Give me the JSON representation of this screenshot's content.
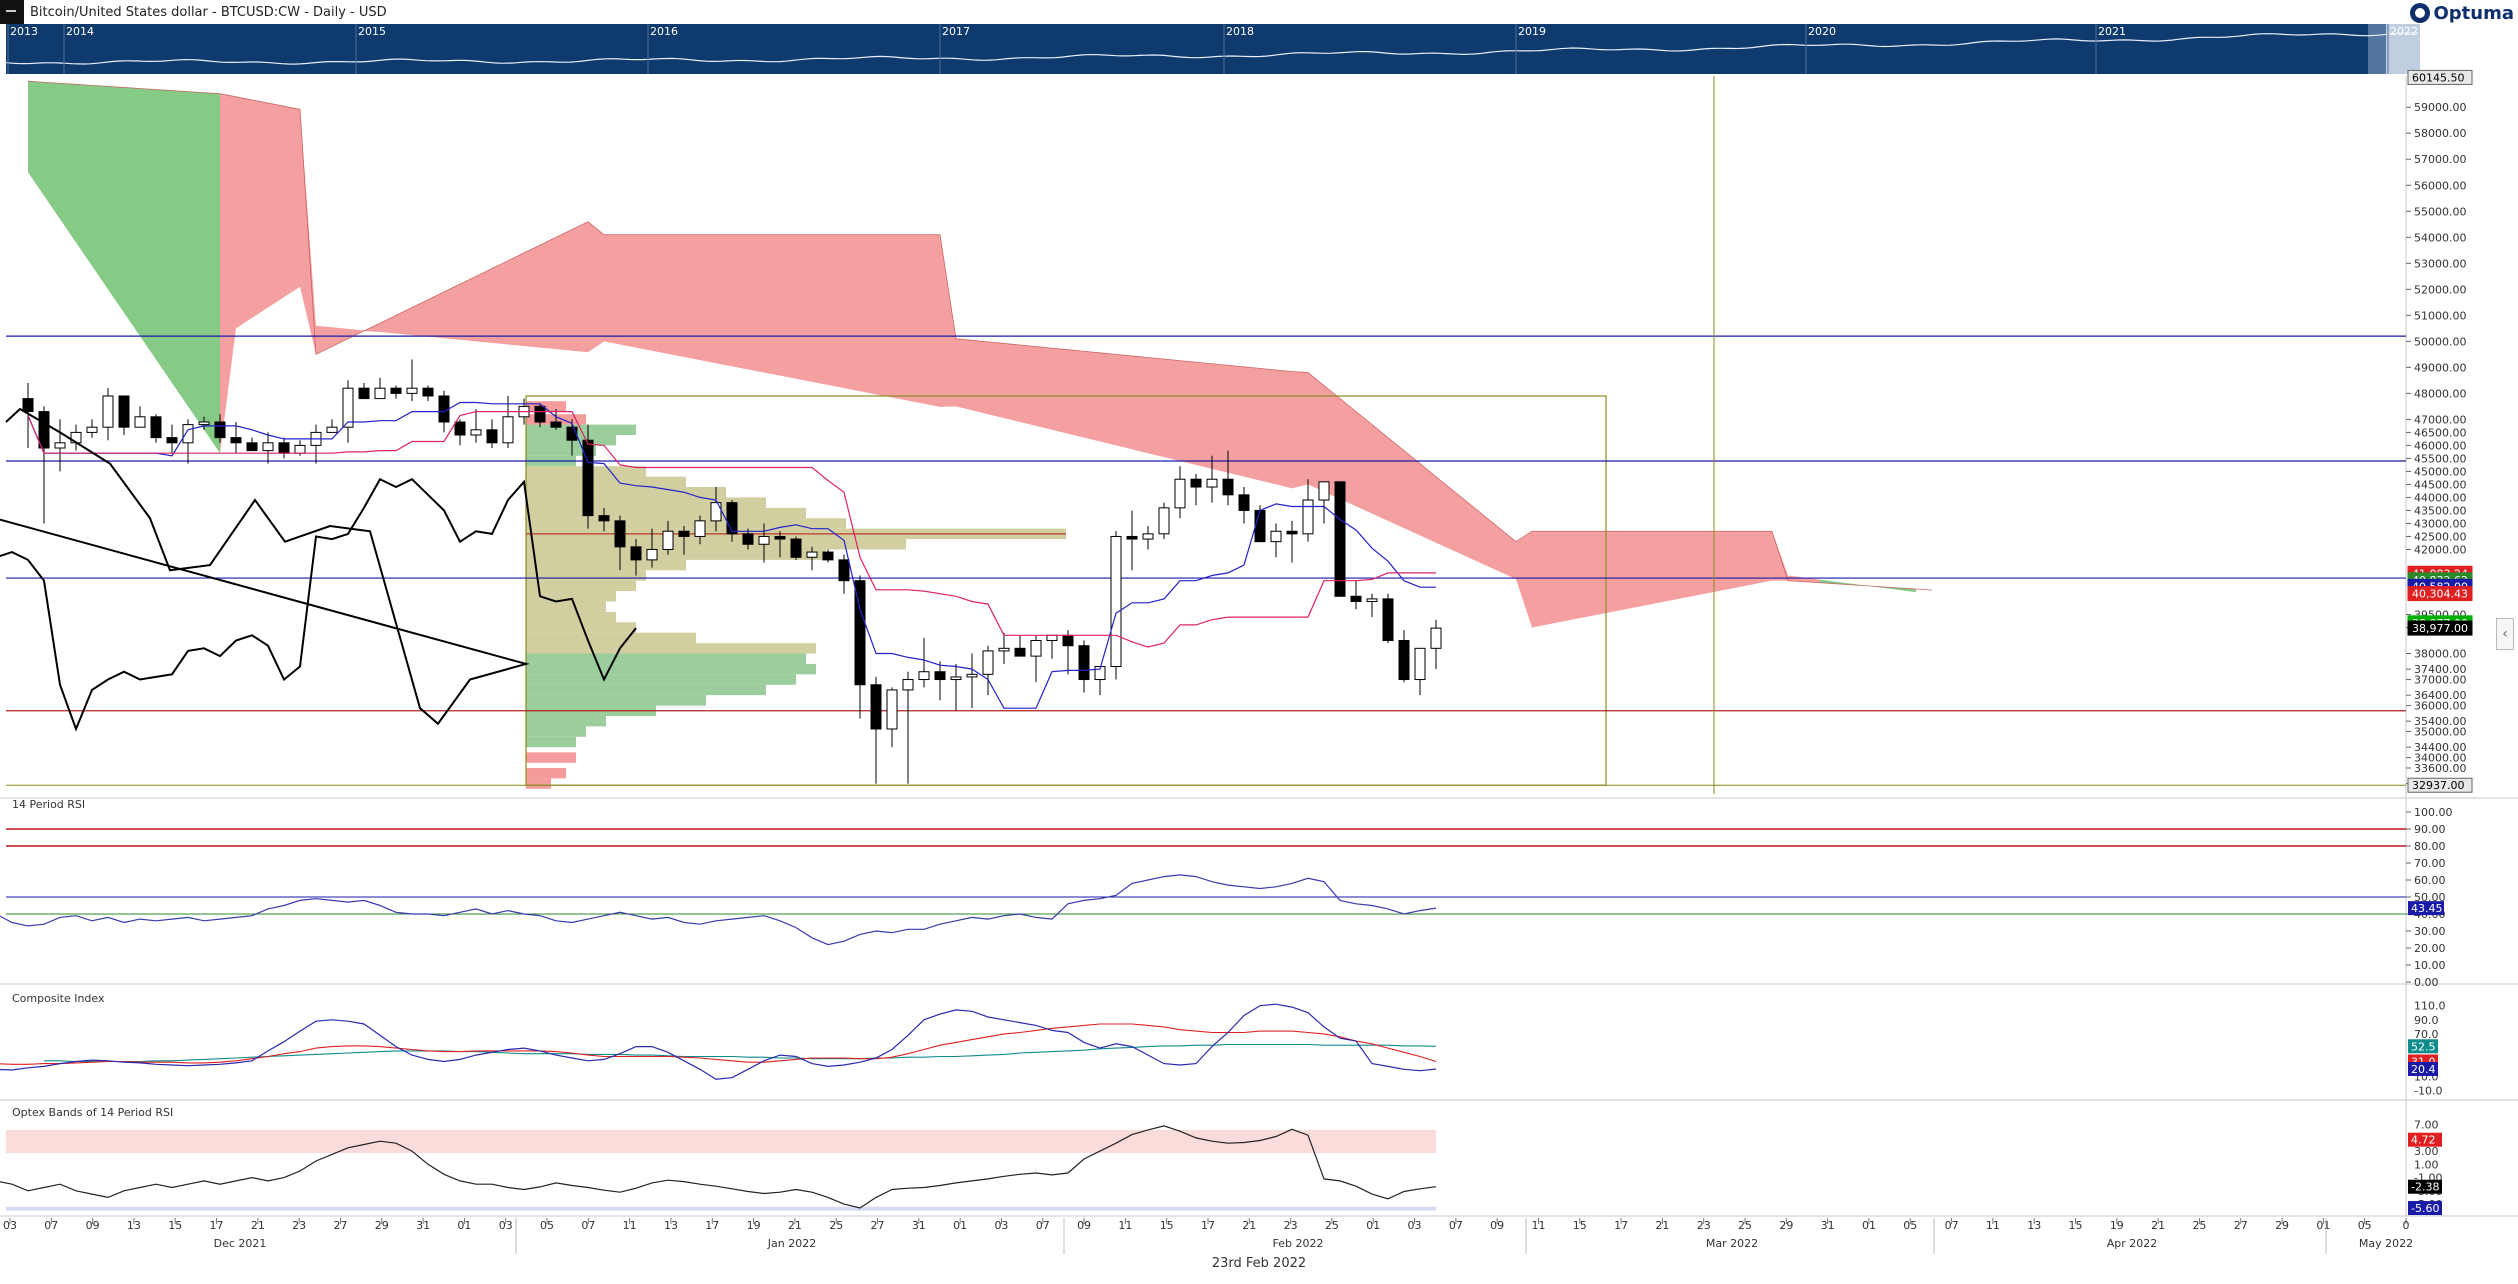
{
  "header": {
    "title": "Bitcoin/United States dollar - BTCUSD:CW - Daily - USD"
  },
  "logo": {
    "text": "Optuma"
  },
  "footer": {
    "date": "23rd Feb 2022"
  },
  "overview": {
    "years": [
      "2013",
      "2014",
      "2015",
      "2016",
      "2017",
      "2018",
      "2019",
      "2020",
      "2021",
      "2022"
    ]
  },
  "price_panel": {
    "y_ticks": [
      59000,
      58000,
      57000,
      56000,
      55000,
      54000,
      53000,
      52000,
      51000,
      50000,
      49000,
      48000,
      47000,
      46500,
      46000,
      45500,
      45000,
      44500,
      44000,
      43500,
      43000,
      42500,
      42000,
      39500,
      39000,
      38000,
      37400,
      37000,
      36400,
      36000,
      35400,
      35000,
      34400,
      34000,
      33600,
      33000
    ],
    "price_badges": [
      {
        "text": "60145.50",
        "value": 60145.5,
        "bg": "#e8e8e8",
        "fg": "#000"
      },
      {
        "text": "41,083.24",
        "value": 41083.24,
        "bg": "#e02020",
        "fg": "#fff"
      },
      {
        "text": "40,832.62",
        "value": 40832.62,
        "bg": "#2a8a2a",
        "fg": "#fff"
      },
      {
        "text": "40,582.00",
        "value": 40582,
        "bg": "#1a1aa8",
        "fg": "#fff"
      },
      {
        "text": "40,304.43",
        "value": 40304.43,
        "bg": "#e02020",
        "fg": "#fff"
      },
      {
        "text": "38,977.00",
        "value": 39180,
        "bg": "#00b000",
        "fg": "#fff"
      },
      {
        "text": "38,977.00",
        "value": 38977,
        "bg": "#000",
        "fg": "#fff"
      },
      {
        "text": "32937.00",
        "value": 32937,
        "bg": "#e8e8e8",
        "fg": "#000"
      }
    ]
  },
  "rsi_panel": {
    "title": "14 Period RSI",
    "y_ticks": [
      "100.00",
      "90.00",
      "80.00",
      "70.00",
      "60.00",
      "50.00",
      "40.00",
      "30.00",
      "20.00",
      "10.00",
      "0.00"
    ],
    "badge": "43.45",
    "badge_color": "#1a1aa8"
  },
  "ci_panel": {
    "title": "Composite Index",
    "y_ticks": [
      "110.0",
      "90.0",
      "70.0",
      "30.0",
      "10.0",
      "-10.0"
    ],
    "badges": [
      {
        "text": "52.5",
        "bg": "#0e8b8b"
      },
      {
        "text": "31.0",
        "bg": "#e02020"
      },
      {
        "text": "20.4",
        "bg": "#1a1aa8"
      }
    ]
  },
  "optex_panel": {
    "title": "Optex Bands of 14 Period RSI",
    "y_ticks": [
      "7.00",
      "5.00",
      "3.00",
      "1.00",
      "-1.00",
      "-3.00",
      "-5.00"
    ],
    "badges": [
      {
        "text": "4.72",
        "value": 4.72,
        "bg": "#e02020"
      },
      {
        "text": "-2.38",
        "value": -2.38,
        "bg": "#000"
      },
      {
        "text": "-5.60",
        "value": -5.6,
        "bg": "#1a1aa8"
      }
    ]
  },
  "x_axis": {
    "day_labels": [
      "03",
      "07",
      "09",
      "13",
      "15",
      "17",
      "21",
      "23",
      "27",
      "29",
      "31",
      "01",
      "03",
      "05",
      "07",
      "11",
      "13",
      "17",
      "19",
      "21",
      "25",
      "27",
      "31",
      "01",
      "03",
      "07",
      "09",
      "11",
      "15",
      "17",
      "21",
      "23",
      "25",
      "01",
      "03",
      "07",
      "09",
      "11",
      "15",
      "17",
      "21",
      "23",
      "25",
      "29",
      "31",
      "01",
      "05",
      "07",
      "11",
      "13",
      "15",
      "19",
      "21",
      "25",
      "27",
      "29",
      "01",
      "05",
      "0"
    ],
    "month_labels": [
      "Dec 2021",
      "Jan 2022",
      "Feb 2022",
      "Mar 2022",
      "Apr 2022",
      "May 2022"
    ]
  },
  "colors": {
    "bull_cloud": "#f08080",
    "bear_cloud": "#5cb85c",
    "tenkan": "#2222cc",
    "kijun": "#dd2266",
    "chikou": "#000000",
    "volume_up": "#8bc48b",
    "volume_neutral": "#c9c58f",
    "volume_down": "#f28b8b",
    "navy": "#0e3a6e"
  },
  "chart_data": {
    "type": "candlestick",
    "title": "Bitcoin/United States dollar - BTCUSD:CW - Daily - USD",
    "ylim": [
      32600,
      60200
    ],
    "candles": [
      [
        47800,
        48400,
        45900,
        47300
      ],
      [
        47300,
        47500,
        43000,
        45900
      ],
      [
        45900,
        47000,
        45000,
        46100
      ],
      [
        46100,
        46800,
        45800,
        46500
      ],
      [
        46500,
        47000,
        46300,
        46700
      ],
      [
        46700,
        48200,
        46200,
        47900
      ],
      [
        47900,
        47900,
        46400,
        46700
      ],
      [
        46700,
        47500,
        47000,
        47100
      ],
      [
        47100,
        47200,
        46100,
        46300
      ],
      [
        46300,
        46800,
        45700,
        46100
      ],
      [
        46100,
        47000,
        45300,
        46800
      ],
      [
        46800,
        47100,
        46600,
        46900
      ],
      [
        46900,
        47200,
        46100,
        46300
      ],
      [
        46300,
        46900,
        45700,
        46100
      ],
      [
        46100,
        46300,
        45800,
        45800
      ],
      [
        45800,
        46500,
        45300,
        46100
      ],
      [
        46100,
        46300,
        45500,
        45700
      ],
      [
        45700,
        46200,
        45600,
        46000
      ],
      [
        46000,
        46800,
        45300,
        46500
      ],
      [
        46500,
        47000,
        46500,
        46700
      ],
      [
        46700,
        48500,
        46100,
        48200
      ],
      [
        48200,
        48400,
        47800,
        47800
      ],
      [
        47800,
        48600,
        47800,
        48200
      ],
      [
        48200,
        48300,
        47800,
        48000
      ],
      [
        48000,
        49300,
        47700,
        48200
      ],
      [
        48200,
        48300,
        47700,
        47900
      ],
      [
        47900,
        48100,
        46500,
        46900
      ],
      [
        46900,
        47000,
        46000,
        46400
      ],
      [
        46400,
        47400,
        46100,
        46600
      ],
      [
        46600,
        47000,
        45900,
        46100
      ],
      [
        46100,
        47900,
        45900,
        47100
      ],
      [
        47100,
        47800,
        46800,
        47500
      ],
      [
        47500,
        47600,
        46700,
        46900
      ],
      [
        46900,
        47400,
        46600,
        46700
      ],
      [
        46700,
        47000,
        45600,
        46200
      ],
      [
        46200,
        46800,
        42800,
        43300
      ],
      [
        43300,
        43600,
        42700,
        43100
      ],
      [
        43100,
        43300,
        41200,
        42100
      ],
      [
        42100,
        42400,
        41000,
        41600
      ],
      [
        41600,
        42800,
        41300,
        42000
      ],
      [
        42000,
        43100,
        41800,
        42700
      ],
      [
        42700,
        42900,
        41800,
        42500
      ],
      [
        42500,
        43300,
        42200,
        43100
      ],
      [
        43100,
        44400,
        42700,
        43800
      ],
      [
        43800,
        43900,
        42300,
        42600
      ],
      [
        42600,
        42800,
        42000,
        42200
      ],
      [
        42200,
        43000,
        41500,
        42500
      ],
      [
        42500,
        42700,
        41700,
        42400
      ],
      [
        42400,
        42500,
        41600,
        41700
      ],
      [
        41700,
        42100,
        41200,
        41900
      ],
      [
        41900,
        42000,
        41500,
        41600
      ],
      [
        41600,
        41800,
        40300,
        40800
      ],
      [
        40800,
        41000,
        35500,
        36800
      ],
      [
        36800,
        37100,
        33000,
        35100
      ],
      [
        35100,
        36700,
        34400,
        36600
      ],
      [
        36600,
        37300,
        33000,
        37000
      ],
      [
        37000,
        38600,
        36700,
        37300
      ],
      [
        37300,
        37700,
        36200,
        37000
      ],
      [
        37000,
        37600,
        35800,
        37100
      ],
      [
        37100,
        38000,
        35900,
        37200
      ],
      [
        37200,
        38300,
        36400,
        38100
      ],
      [
        38100,
        38800,
        37600,
        38200
      ],
      [
        38200,
        38700,
        37900,
        37900
      ],
      [
        37900,
        38700,
        36900,
        38500
      ],
      [
        38500,
        38700,
        37800,
        38700
      ],
      [
        38700,
        38900,
        37200,
        38300
      ],
      [
        38300,
        38500,
        36500,
        37000
      ],
      [
        37000,
        37500,
        36400,
        37500
      ],
      [
        37500,
        42700,
        37000,
        42500
      ],
      [
        42500,
        43500,
        41200,
        42400
      ],
      [
        42400,
        42900,
        42000,
        42600
      ],
      [
        42600,
        43800,
        42400,
        43600
      ],
      [
        43600,
        45200,
        43200,
        44700
      ],
      [
        44700,
        44900,
        43700,
        44400
      ],
      [
        44400,
        45600,
        43800,
        44700
      ],
      [
        44700,
        45800,
        43700,
        44100
      ],
      [
        44100,
        44400,
        43000,
        43500
      ],
      [
        43500,
        43700,
        42300,
        42300
      ],
      [
        42300,
        43000,
        41700,
        42700
      ],
      [
        42700,
        43100,
        41500,
        42600
      ],
      [
        42600,
        44700,
        42300,
        43900
      ],
      [
        43900,
        44500,
        43000,
        44600
      ],
      [
        44600,
        44600,
        40500,
        40200
      ],
      [
        40200,
        40800,
        39700,
        40000
      ],
      [
        40000,
        40300,
        39400,
        40100
      ],
      [
        40100,
        40300,
        38400,
        38500
      ],
      [
        38500,
        38900,
        36900,
        37000
      ],
      [
        37000,
        38200,
        36400,
        38200
      ],
      [
        38200,
        39300,
        37400,
        38977
      ]
    ],
    "horizontal_levels": [
      {
        "value": 50200,
        "color": "#1a1aa8"
      },
      {
        "value": 45400,
        "color": "#1a1aa8"
      },
      {
        "value": 40900,
        "color": "#1a1aa8"
      },
      {
        "value": 35800,
        "color": "#b02020"
      }
    ],
    "rsi": [
      36,
      40,
      35,
      33,
      34,
      38,
      39,
      36,
      38,
      35,
      37,
      36,
      37,
      38,
      36,
      37,
      38,
      39,
      43,
      45,
      48,
      49,
      48,
      47,
      48,
      45,
      41,
      40,
      40,
      39,
      41,
      43,
      40,
      42,
      40,
      39,
      36,
      35,
      37,
      39,
      41,
      39,
      37,
      38,
      35,
      34,
      36,
      37,
      38,
      39,
      36,
      32,
      26,
      22,
      24,
      28,
      30,
      29,
      31,
      31,
      34,
      36,
      38,
      37,
      39,
      40,
      38,
      37,
      46,
      48,
      49,
      51,
      58,
      60,
      62,
      63,
      62,
      59,
      57,
      56,
      55,
      56,
      58,
      61,
      59,
      48,
      46,
      45,
      43,
      40,
      42,
      43.45
    ],
    "ci_blue": [
      24,
      22,
      20,
      19,
      22,
      24,
      28,
      31,
      33,
      32,
      30,
      29,
      27,
      26,
      25,
      26,
      27,
      29,
      32,
      46,
      59,
      74,
      88,
      90,
      88,
      84,
      68,
      52,
      40,
      34,
      31,
      34,
      40,
      44,
      48,
      50,
      46,
      40,
      36,
      32,
      34,
      42,
      52,
      52,
      44,
      32,
      20,
      6,
      8,
      20,
      32,
      40,
      38,
      28,
      24,
      26,
      30,
      36,
      48,
      68,
      90,
      98,
      104,
      102,
      94,
      90,
      86,
      82,
      75,
      72,
      58,
      50,
      56,
      52,
      40,
      28,
      26,
      28,
      52,
      72,
      96,
      110,
      112,
      108,
      100,
      80,
      64,
      60,
      28,
      24,
      20,
      18,
      20.4
    ],
    "ci_red": [
      30,
      29,
      28,
      27,
      27,
      28,
      28,
      29,
      30,
      31,
      31,
      30,
      30,
      30,
      29,
      29,
      30,
      32,
      35,
      38,
      42,
      45,
      50,
      52,
      53,
      53,
      52,
      50,
      48,
      46,
      45,
      45,
      46,
      46,
      46,
      46,
      46,
      45,
      43,
      40,
      38,
      38,
      38,
      38,
      38,
      37,
      36,
      34,
      32,
      30,
      30,
      32,
      34,
      36,
      36,
      36,
      35,
      35,
      37,
      42,
      48,
      54,
      58,
      62,
      66,
      70,
      72,
      75,
      78,
      80,
      82,
      84,
      84,
      84,
      82,
      80,
      76,
      74,
      72,
      72,
      72,
      74,
      74,
      74,
      72,
      70,
      66,
      60,
      56,
      50,
      44,
      38,
      31.0
    ],
    "ci_teal": [
      32,
      32,
      31,
      31,
      31,
      31,
      31,
      32,
      32,
      33,
      34,
      35,
      36,
      37,
      38,
      39,
      40,
      41,
      42,
      43,
      44,
      45,
      46,
      46,
      46,
      46,
      45,
      45,
      44,
      43,
      42,
      42,
      42,
      42,
      41,
      41,
      41,
      40,
      40,
      39,
      38,
      38,
      38,
      38,
      37,
      37,
      36,
      36,
      35,
      35,
      35,
      35,
      36,
      36,
      37,
      37,
      38,
      38,
      39,
      40,
      41,
      43,
      44,
      45,
      46,
      47,
      49,
      50,
      51,
      52,
      53,
      53,
      54,
      54,
      55,
      55,
      55,
      55,
      55,
      55,
      54,
      54,
      54,
      54,
      54,
      53,
      53,
      52.5
    ],
    "optex": [
      -1.5,
      -2,
      -3,
      -2.5,
      -2,
      -3,
      -3.5,
      -4,
      -3,
      -2.5,
      -2,
      -2.5,
      -2,
      -1.5,
      -2,
      -1.5,
      -1,
      -1.5,
      -1,
      0,
      1.5,
      2.5,
      3.5,
      4,
      4.5,
      4.2,
      3,
      1,
      -0.5,
      -1.5,
      -2,
      -2,
      -2.5,
      -2.8,
      -2.4,
      -1.8,
      -2.2,
      -2.5,
      -2.9,
      -3.2,
      -2.6,
      -1.8,
      -1.4,
      -1.6,
      -2,
      -2.3,
      -2.7,
      -3.1,
      -3.4,
      -3.2,
      -2.8,
      -3.2,
      -4,
      -5,
      -5.6,
      -4,
      -2.8,
      -2.6,
      -2.5,
      -2.2,
      -1.8,
      -1.5,
      -1.2,
      -0.8,
      -0.5,
      -0.3,
      -0.6,
      -0.3,
      1.8,
      3,
      4.2,
      5.5,
      6.2,
      6.8,
      6,
      5,
      4.5,
      4.2,
      4.3,
      4.6,
      5.2,
      6.3,
      5.4,
      -1.2,
      -1.5,
      -2.3,
      -3.5,
      -4.2,
      -3.1,
      -2.7,
      -2.38
    ]
  }
}
